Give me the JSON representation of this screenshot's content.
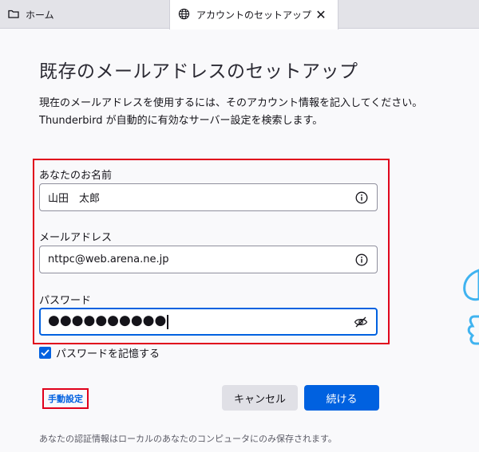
{
  "tabs": [
    {
      "label": "ホーム",
      "icon": "folder-icon"
    },
    {
      "label": "アカウントのセットアップ",
      "icon": "globe-icon"
    }
  ],
  "close_symbol": "✕",
  "page": {
    "title": "既存のメールアドレスのセットアップ",
    "description_line1": "現在のメールアドレスを使用するには、そのアカウント情報を記入してください。",
    "description_line2": "Thunderbird が自動的に有効なサーバー設定を検索します。"
  },
  "form": {
    "name_label": "あなたのお名前",
    "name_value": "山田　太郎",
    "email_label": "メールアドレス",
    "email_value": "nttpc@web.arena.ne.jp",
    "password_label": "パスワード",
    "password_value": "●●●●●●●●●●",
    "remember_label": "パスワードを記憶する",
    "remember_checked": true
  },
  "actions": {
    "manual_label": "手動設定",
    "cancel_label": "キャンセル",
    "continue_label": "続ける"
  },
  "footer": {
    "note": "あなたの認証情報はローカルのあなたのコンピュータにのみ保存されます。"
  },
  "colors": {
    "accent": "#0061e0",
    "highlight": "#e0001b",
    "illustration": "#3fb3f0"
  }
}
